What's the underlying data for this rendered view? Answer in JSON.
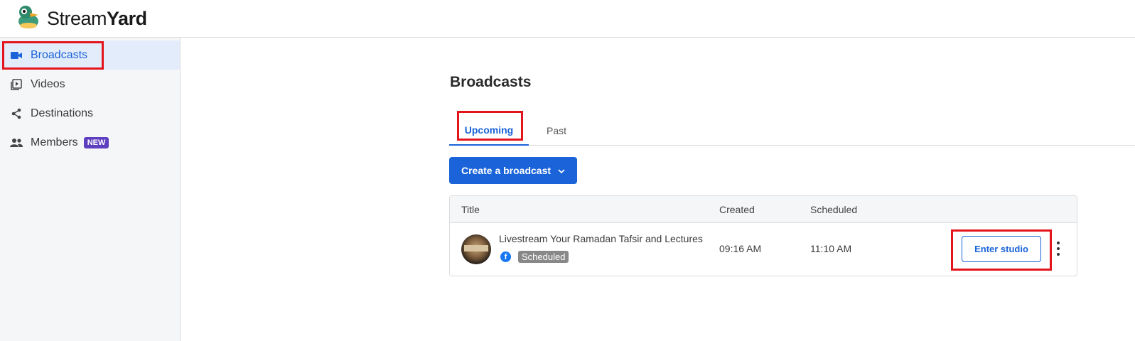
{
  "app": {
    "brand_prefix": "Stream",
    "brand_suffix": "Yard"
  },
  "sidebar": {
    "items": [
      {
        "label": "Broadcasts",
        "icon": "video-camera-icon",
        "active": true
      },
      {
        "label": "Videos",
        "icon": "video-library-icon",
        "active": false
      },
      {
        "label": "Destinations",
        "icon": "share-icon",
        "active": false
      },
      {
        "label": "Members",
        "icon": "people-icon",
        "active": false,
        "badge": "NEW"
      }
    ]
  },
  "main": {
    "title": "Broadcasts",
    "tabs": [
      {
        "label": "Upcoming",
        "active": true
      },
      {
        "label": "Past",
        "active": false
      }
    ],
    "create_button": "Create a broadcast",
    "table": {
      "headers": {
        "title": "Title",
        "created": "Created",
        "scheduled": "Scheduled"
      },
      "rows": [
        {
          "title": "Livestream Your Ramadan Tafsir and Lectures",
          "destination_icon": "facebook-icon",
          "status": "Scheduled",
          "created": "09:16 AM",
          "scheduled": "11:10 AM",
          "action": "Enter studio"
        }
      ]
    }
  },
  "colors": {
    "accent": "#1a63d8",
    "highlight": "#e3141c",
    "badge_new": "#5e3fbf",
    "facebook": "#1877f2"
  }
}
